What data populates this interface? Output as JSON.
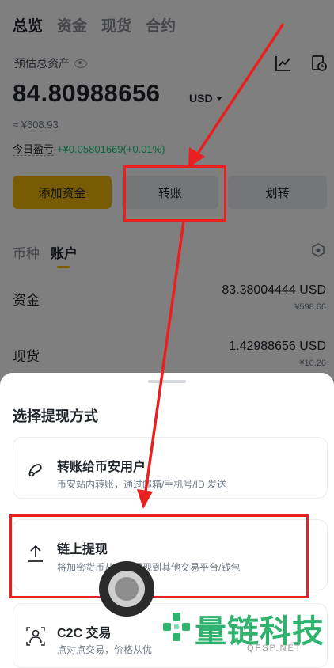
{
  "header": {
    "tabs": [
      "总览",
      "资金",
      "现货",
      "合约"
    ],
    "active_tab": 0
  },
  "balance": {
    "label": "预估总资产",
    "amount": "84.80988656",
    "currency": "USD",
    "fiat_approx": "≈ ¥608.93",
    "pnl_label": "今日盈亏",
    "pnl_value": "+¥0.05801669(+0.01%)"
  },
  "actions": {
    "add_funds": "添加资金",
    "transfer": "转账",
    "move": "划转"
  },
  "subtabs": [
    "币种",
    "账户"
  ],
  "accounts": [
    {
      "name": "资金",
      "value": "83.38004444 USD",
      "fiat": "¥598.66"
    },
    {
      "name": "现货",
      "value": "1.42988656 USD",
      "fiat": "¥10.26"
    }
  ],
  "sheet": {
    "title": "选择提现方式",
    "options": [
      {
        "icon": "user-transfer-icon",
        "title": "转账给币安用户",
        "desc": "币安站内转账，通过邮箱/手机号/ID 发送"
      },
      {
        "icon": "upload-icon",
        "title": "链上提现",
        "desc": "将加密货币从币安提现到其他交易平台/钱包"
      },
      {
        "icon": "people-icon",
        "title": "C2C 交易",
        "desc": "点对点交易，价格从优"
      }
    ]
  },
  "watermark": {
    "text": "量链科技",
    "url": "QFSP.NET"
  },
  "colors": {
    "accent": "#f0b90b",
    "positive": "#0ecb81",
    "annotation": "#e8201f",
    "watermark": "#2fb36e"
  }
}
